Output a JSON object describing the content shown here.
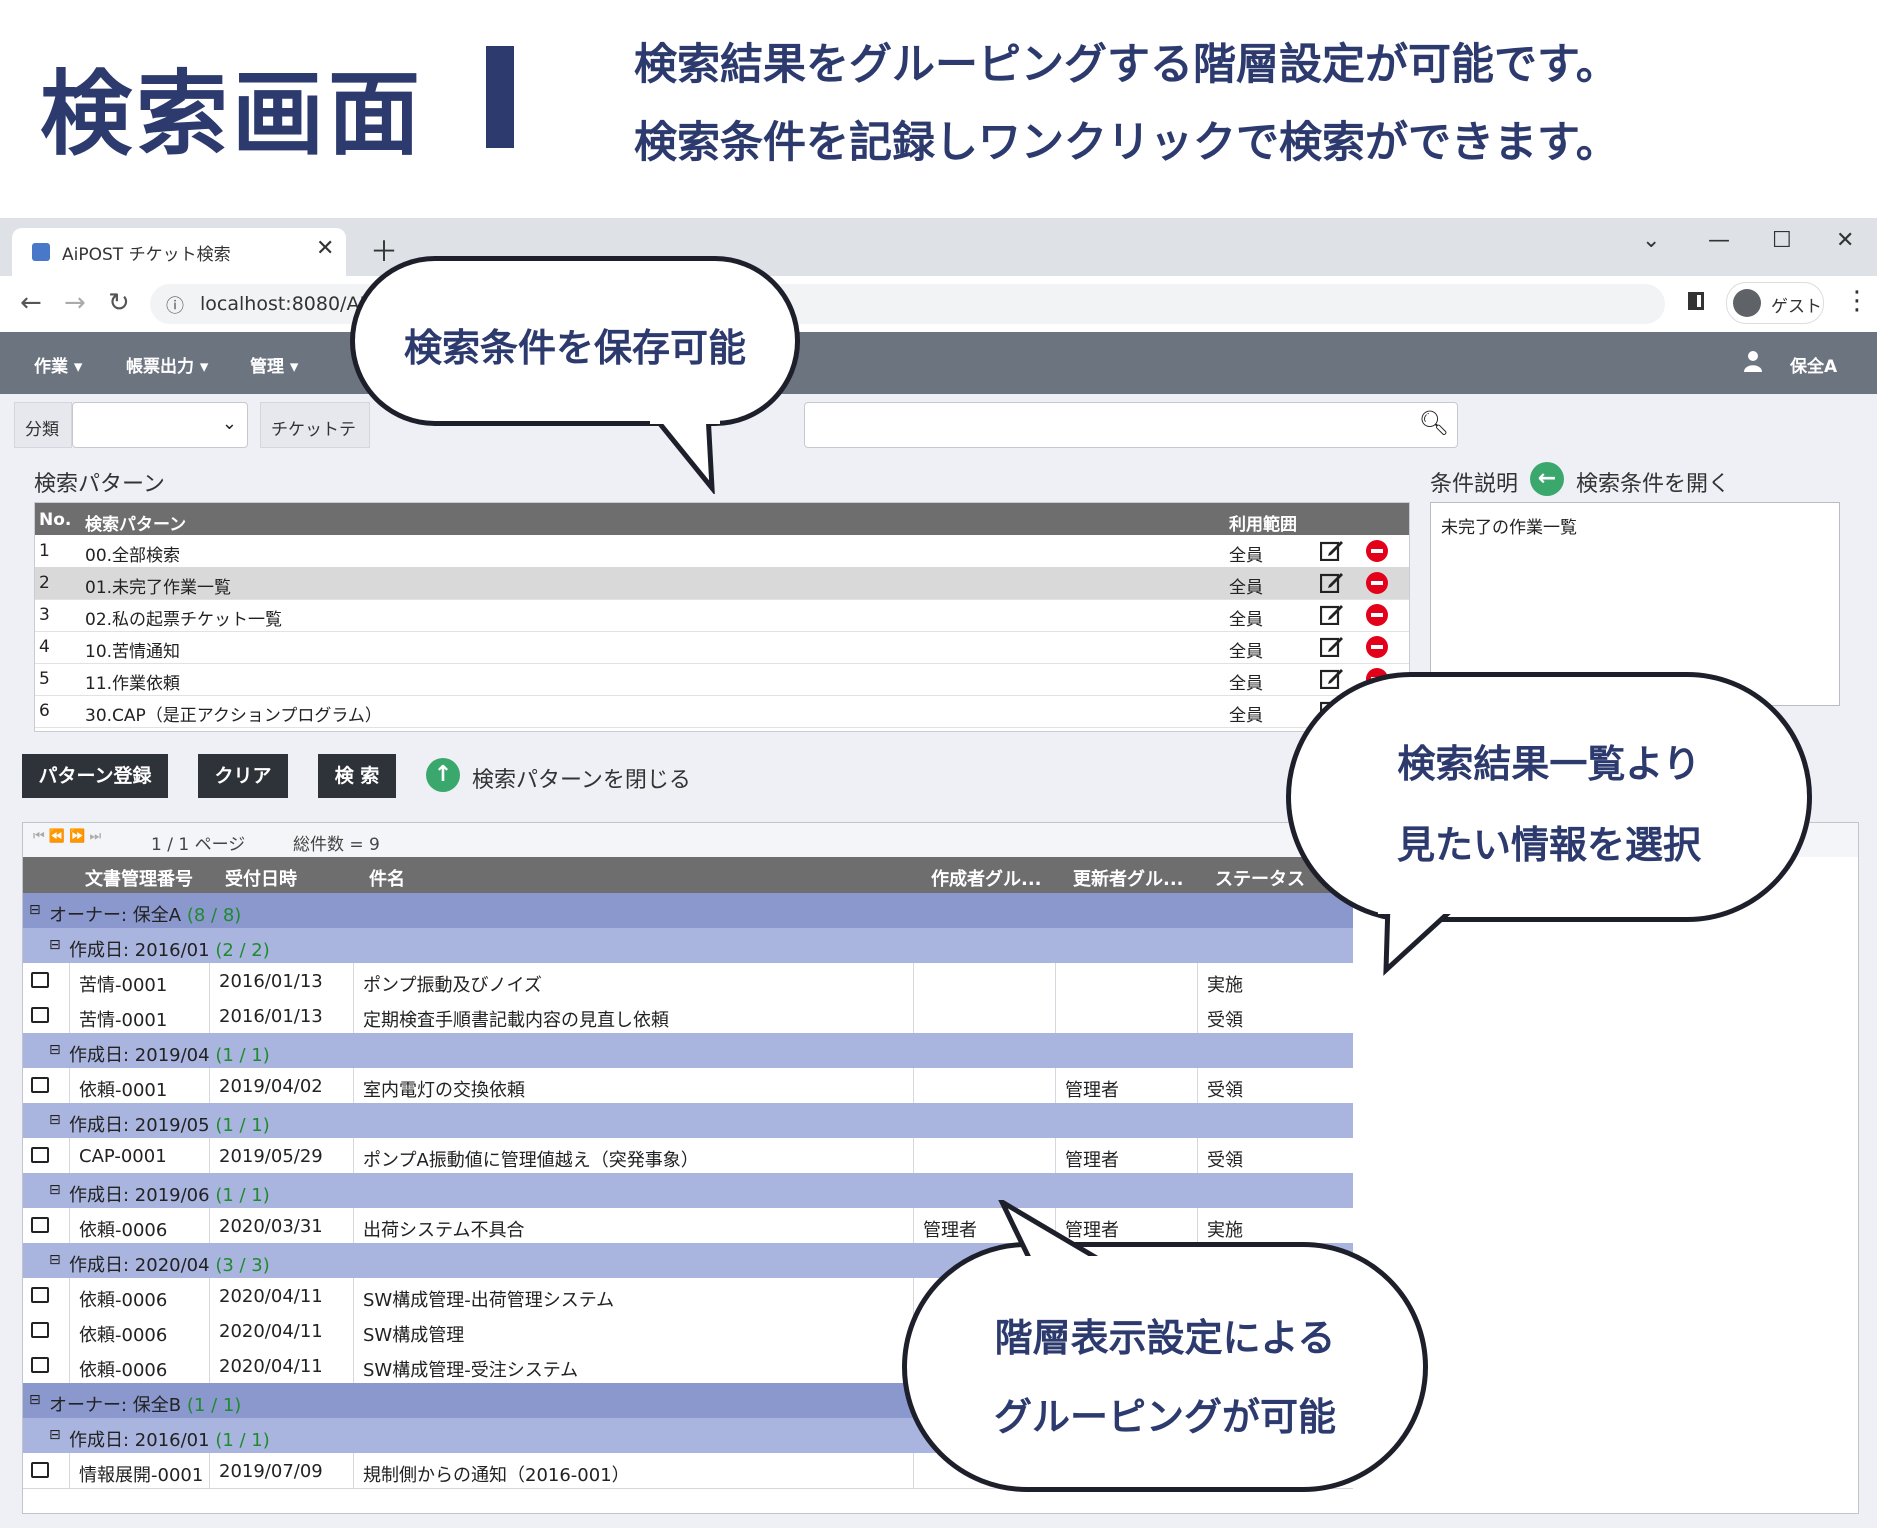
{
  "header": {
    "title": "検索画面",
    "line1": "検索結果をグルーピングする階層設定が可能です。",
    "line2": "検索条件を記録しワンクリックで検索ができます。"
  },
  "browser": {
    "tab_title": "AiPOST チケット検索",
    "url": "localhost:8080/AIP",
    "guest_label": "ゲスト"
  },
  "navbar": {
    "items": [
      "作業 ▾",
      "帳票出力 ▾",
      "管理 ▾"
    ],
    "user": "保全A"
  },
  "search": {
    "category_label": "分類",
    "ticket_label": "チケットテ"
  },
  "patterns": {
    "section_label": "検索パターン",
    "col_no": "No.",
    "col_name": "検索パターン",
    "col_scope": "利用範囲",
    "rows": [
      {
        "no": "1",
        "name": "00.全部検索",
        "scope": "全員"
      },
      {
        "no": "2",
        "name": "01.未完了作業一覧",
        "scope": "全員"
      },
      {
        "no": "3",
        "name": "02.私の起票チケット一覧",
        "scope": "全員"
      },
      {
        "no": "4",
        "name": "10.苦情通知",
        "scope": "全員"
      },
      {
        "no": "5",
        "name": "11.作業依頼",
        "scope": "全員"
      },
      {
        "no": "6",
        "name": "30.CAP（是正アクションプログラム）",
        "scope": "全員"
      }
    ]
  },
  "condition": {
    "label": "条件説明",
    "open_label": "検索条件を開く",
    "text": "未完了の作業一覧"
  },
  "buttons": {
    "register": "パターン登録",
    "clear": "クリア",
    "search": "検 索",
    "close_patterns": "検索パターンを閉じる"
  },
  "grid": {
    "page": "1 / 1 ページ",
    "total": "総件数 = 9",
    "columns": [
      "文書管理番号",
      "受付日時",
      "件名",
      "作成者グル...",
      "更新者グル...",
      "ステータス"
    ],
    "rows": [
      {
        "kind": "g1",
        "label": "オーナー: 保全A",
        "count": "(8 / 8)"
      },
      {
        "kind": "g2",
        "label": "作成日: 2016/01",
        "count": "(2 / 2)"
      },
      {
        "kind": "d",
        "cells": [
          "苦情-0001",
          "2016/01/13",
          "ポンプ振動及びノイズ",
          "",
          "",
          "実施"
        ]
      },
      {
        "kind": "d",
        "cells": [
          "苦情-0001",
          "2016/01/13",
          "定期検査手順書記載内容の見直し依頼",
          "",
          "",
          "受領"
        ]
      },
      {
        "kind": "g2",
        "label": "作成日: 2019/04",
        "count": "(1 / 1)"
      },
      {
        "kind": "d",
        "cells": [
          "依頼-0001",
          "2019/04/02",
          "室内電灯の交換依頼",
          "",
          "管理者",
          "受領"
        ]
      },
      {
        "kind": "g2",
        "label": "作成日: 2019/05",
        "count": "(1 / 1)"
      },
      {
        "kind": "d",
        "cells": [
          "CAP-0001",
          "2019/05/29",
          "ポンプA振動値に管理値越え（突発事象）",
          "",
          "管理者",
          "受領"
        ]
      },
      {
        "kind": "g2",
        "label": "作成日: 2019/06",
        "count": "(1 / 1)"
      },
      {
        "kind": "d",
        "cells": [
          "依頼-0006",
          "2020/03/31",
          "出荷システム不具合",
          "管理者",
          "管理者",
          "実施"
        ]
      },
      {
        "kind": "g2",
        "label": "作成日: 2020/04",
        "count": "(3 / 3)"
      },
      {
        "kind": "d",
        "cells": [
          "依頼-0006",
          "2020/04/11",
          "SW構成管理-出荷管理システム",
          "",
          "",
          ""
        ]
      },
      {
        "kind": "d",
        "cells": [
          "依頼-0006",
          "2020/04/11",
          "SW構成管理",
          "",
          "",
          ""
        ]
      },
      {
        "kind": "d",
        "cells": [
          "依頼-0006",
          "2020/04/11",
          "SW構成管理-受注システム",
          "",
          "",
          ""
        ]
      },
      {
        "kind": "g1",
        "label": "オーナー: 保全B",
        "count": "(1 / 1)"
      },
      {
        "kind": "g2",
        "label": "作成日: 2016/01",
        "count": "(1 / 1)"
      },
      {
        "kind": "d",
        "cells": [
          "情報展開-0001",
          "2019/07/09",
          "規制側からの通知（2016-001）",
          "",
          "",
          ""
        ]
      }
    ]
  },
  "callouts": {
    "save": "検索条件を保存可能",
    "select1": "検索結果一覧より",
    "select2": "見たい情報を選択",
    "group1": "階層表示設定による",
    "group2": "グルーピングが可能"
  },
  "colors": {
    "brand": "#2c3a6e",
    "group_level1": "#8a98cd",
    "group_level2": "#aab5df",
    "delete_red": "#e3001b",
    "accent_green": "#3aa76d"
  }
}
